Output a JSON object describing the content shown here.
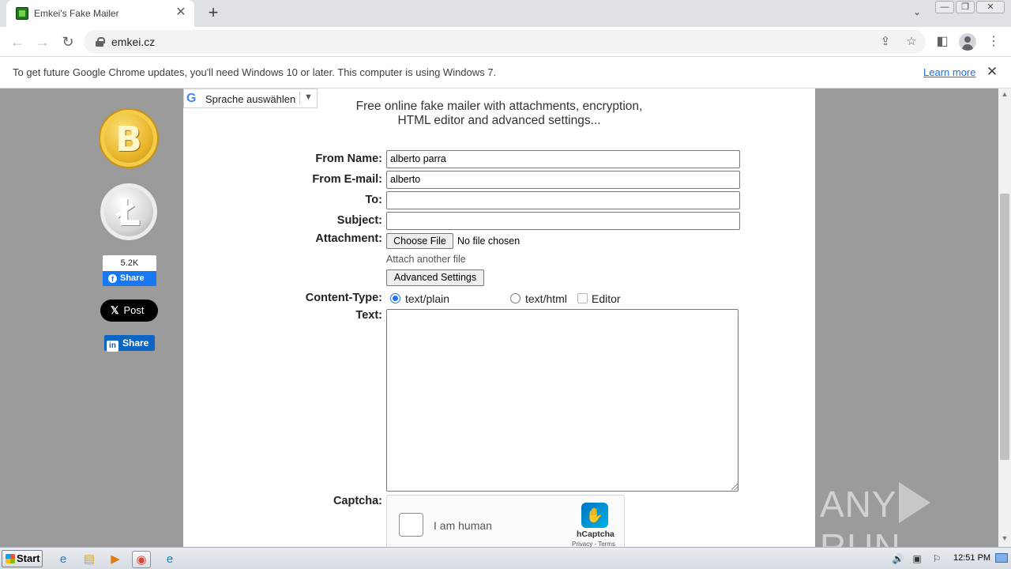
{
  "browser": {
    "tab_title": "Emkei's Fake Mailer",
    "tab_close": "✕",
    "new_tab": "+",
    "tab_search": "⌄",
    "window_controls": {
      "minimize": "—",
      "restore": "❐",
      "close": "✕"
    },
    "nav": {
      "back": "←",
      "forward": "→",
      "reload": "↻"
    },
    "url": "emkei.cz",
    "omnibox_icons": {
      "share": "⇪",
      "bookmark": "☆"
    },
    "toolbar_icons": {
      "side_panel": "◧",
      "menu": "⋮"
    }
  },
  "infobar": {
    "message": "To get future Google Chrome updates, you'll need Windows 10 or later. This computer is using Windows 7.",
    "learn_more": "Learn more",
    "close": "✕"
  },
  "sidebar": {
    "bitcoin_symbol": "B",
    "litecoin_symbol": "Ł",
    "facebook": {
      "count": "5.2K",
      "icon": "f",
      "label": "Share"
    },
    "x": {
      "icon": "𝕏",
      "label": "Post"
    },
    "linkedin": {
      "icon": "in",
      "label": "Share"
    }
  },
  "translate": {
    "icon": "G",
    "label": "Sprache auswählen",
    "arrow": "▼"
  },
  "headline": {
    "line1": "Free online fake mailer with attachments, encryption,",
    "line2": "HTML editor and advanced settings..."
  },
  "form": {
    "from_name_label": "From Name:",
    "from_name_value": "alberto parra",
    "from_email_label": "From E-mail:",
    "from_email_value": "alberto",
    "to_label": "To:",
    "to_value": "",
    "subject_label": "Subject:",
    "subject_value": "",
    "attachment_label": "Attachment:",
    "choose_file": "Choose File",
    "no_file": "No file chosen",
    "attach_another": "Attach another file",
    "advanced_settings": "Advanced Settings",
    "content_type_label": "Content-Type:",
    "content_type_options": [
      "text/plain",
      "text/html"
    ],
    "content_type_selected": "text/plain",
    "editor_label": "Editor",
    "editor_checked": false,
    "text_label": "Text:",
    "text_value": "",
    "captcha_label": "Captcha:"
  },
  "hcaptcha": {
    "label": "I am human",
    "logo_icon": "✋",
    "brand": "hCaptcha",
    "terms": "Privacy - Terms"
  },
  "watermark": {
    "left": "ANY",
    "right": "RUN"
  },
  "taskbar": {
    "start_label": "Start",
    "apps": [
      {
        "name": "internet-explorer",
        "glyph": "e",
        "color": "#1e7fd6"
      },
      {
        "name": "file-explorer",
        "glyph": "▤",
        "color": "#d9a520"
      },
      {
        "name": "media-player",
        "glyph": "▶",
        "color": "#e07b12"
      },
      {
        "name": "chrome",
        "glyph": "◉",
        "color": "#db4437"
      },
      {
        "name": "edge",
        "glyph": "e",
        "color": "#0c8ad6"
      }
    ],
    "tray": {
      "speaker": "🔊",
      "network": "▣",
      "flag": "⚐"
    },
    "clock": "12:51 PM"
  },
  "colors": {
    "page_background": "#9b9b9b",
    "link_blue": "#1a73e8",
    "facebook_blue": "#1877f2",
    "linkedin_blue": "#0a66c2"
  }
}
